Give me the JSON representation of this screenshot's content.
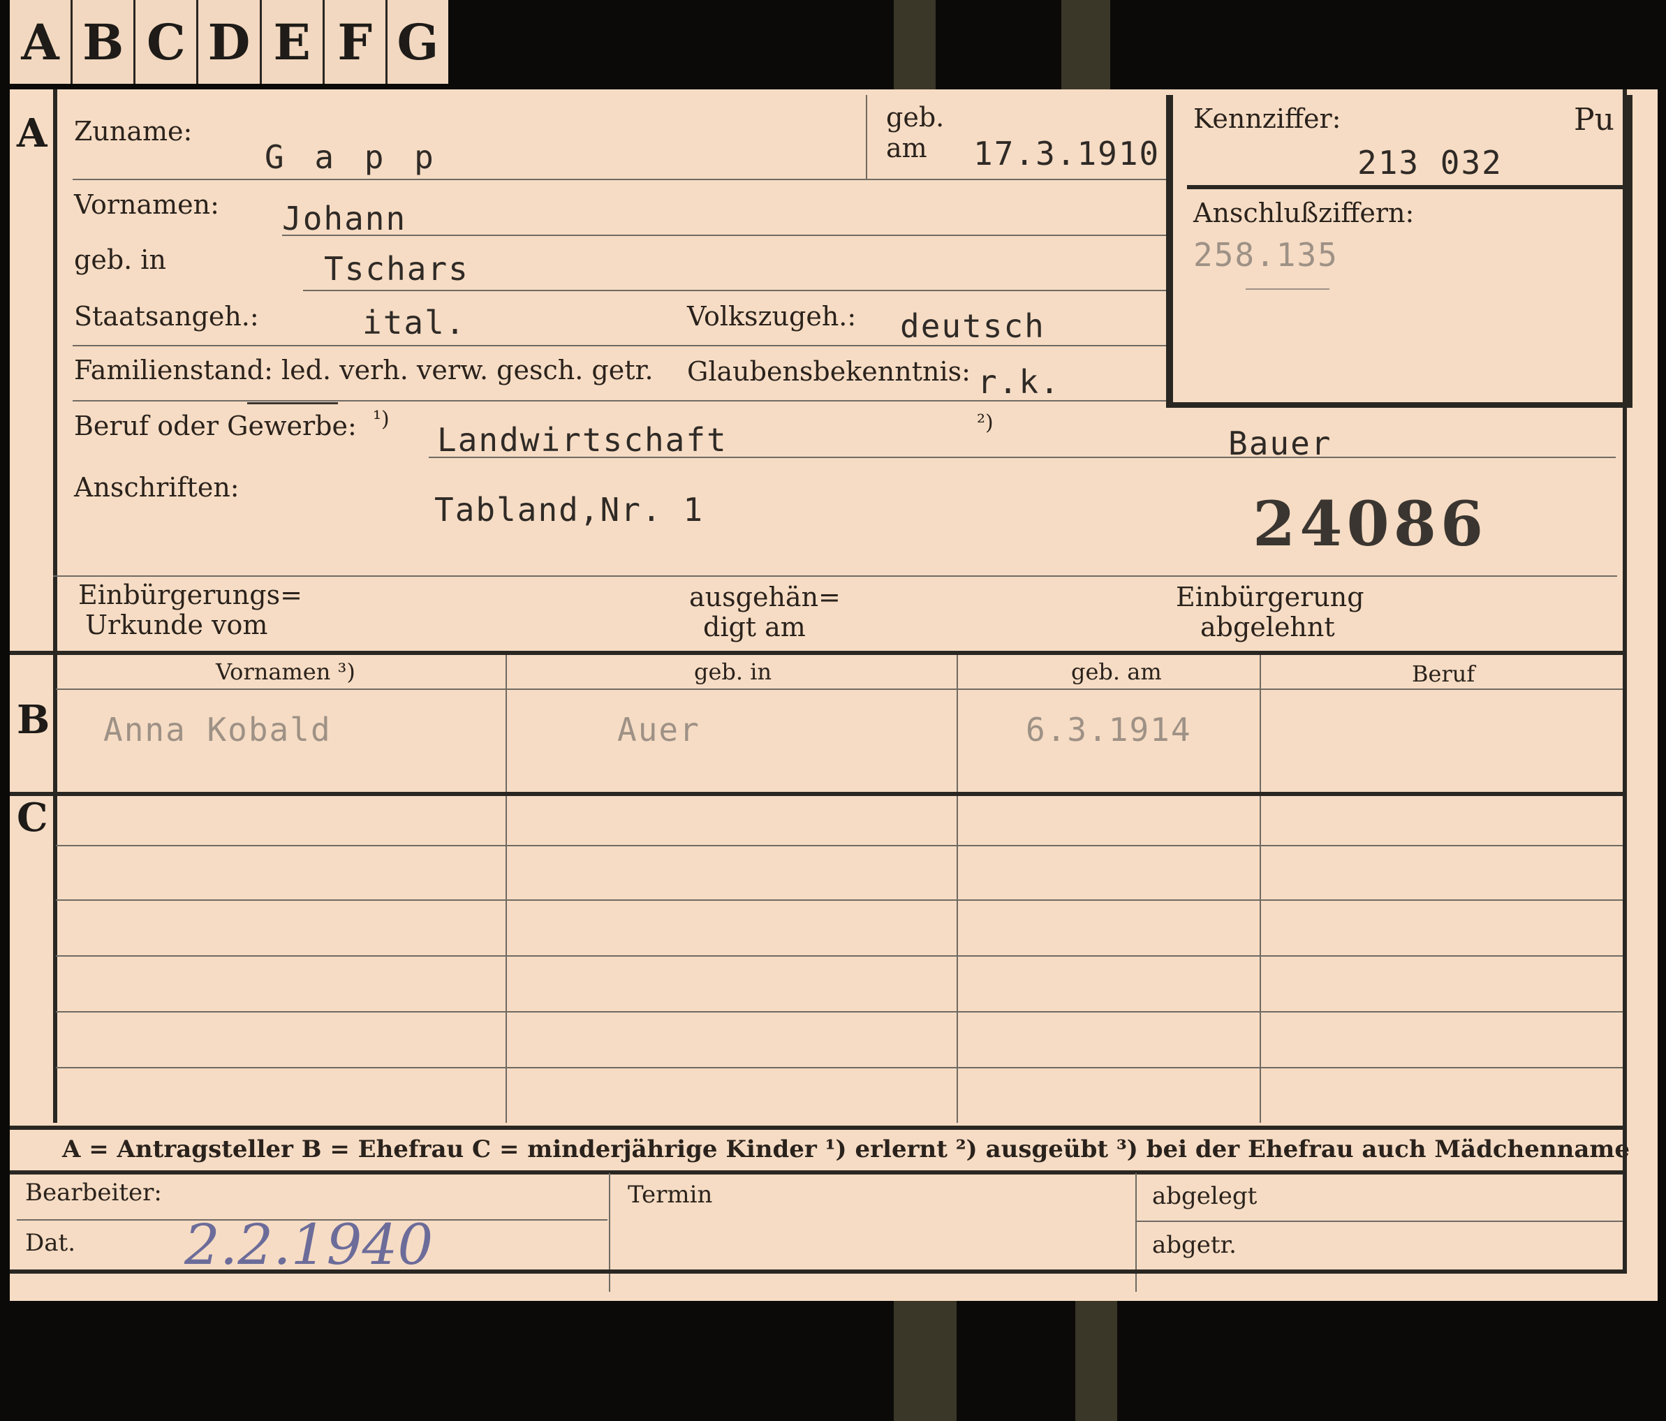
{
  "tabs": [
    "A",
    "B",
    "C",
    "D",
    "E",
    "F",
    "G"
  ],
  "section_letters": {
    "a": "A",
    "b": "B",
    "c": "C"
  },
  "labels": {
    "zuname": "Zuname:",
    "geb_am_1": "geb.",
    "geb_am_2": "am",
    "vornamen": "Vornamen:",
    "geb_in": "geb. in",
    "staatsangeh": "Staatsangeh.:",
    "volkszugeh": "Volkszugeh.:",
    "familienstand": "Familienstand: led. verh. verw. gesch. getr.",
    "glaubensbekenntnis": "Glaubensbekenntnis:",
    "beruf": "Beruf oder Gewerbe:",
    "note1": "¹)",
    "note2": "²)",
    "anschriften": "Anschriften:",
    "einb_urkunde_1": "Einbürgerungs=",
    "einb_urkunde_2": "Urkunde vom",
    "ausgehaendigt_1": "ausgehän=",
    "ausgehaendigt_2": "digt am",
    "einb_abgelehnt_1": "Einbürgerung",
    "einb_abgelehnt_2": "abgelehnt",
    "kennziffer": "Kennziffer:",
    "anschlussziffern": "Anschlußziffern:"
  },
  "values": {
    "zuname": "G a p p",
    "geb_am": "17.3.1910",
    "vornamen": "Johann",
    "geb_in": "Tschars",
    "staatsangeh": "ital.",
    "volkszugeh": "deutsch",
    "glaubensbekenntnis": "r.k.",
    "beruf_erlernt": "Landwirtschaft",
    "beruf_ausgeuebt": "Bauer",
    "anschrift": "Tabland,Nr. 1",
    "stamp_number": "24086",
    "kennziffer_prefix": "Pu",
    "kennziffer": "213 032",
    "anschlussziffern": "258.135"
  },
  "section_b": {
    "headers": [
      "Vornamen ³)",
      "geb. in",
      "geb. am",
      "Beruf"
    ],
    "row": [
      "Anna Kobald",
      "Auer",
      "6.3.1914",
      ""
    ]
  },
  "legend": "A = Antragsteller   B = Ehefrau   C = minderjährige Kinder   ¹) erlernt   ²) ausgeübt   ³) bei der Ehefrau auch Mädchenname",
  "footer": {
    "bearbeiter": "Bearbeiter:",
    "dat": "Dat.",
    "dat_value": "2.2.1940",
    "termin": "Termin",
    "abgelegt": "abgelegt",
    "abgetr": "abgetr."
  }
}
